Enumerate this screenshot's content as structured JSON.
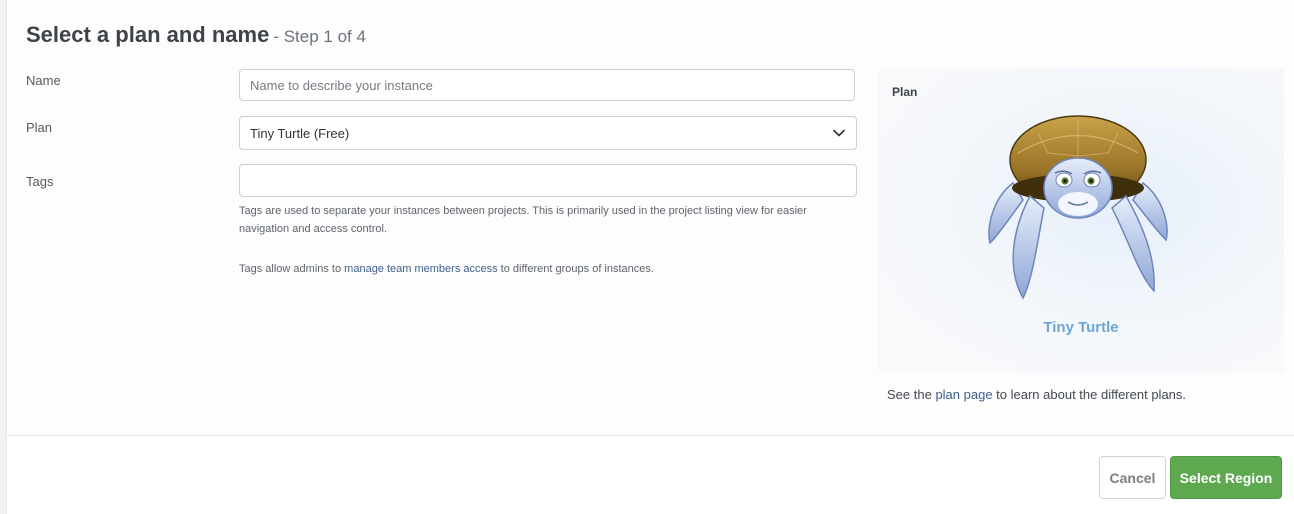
{
  "page": {
    "title": "Select a plan and name",
    "step": "- Step 1 of 4"
  },
  "form": {
    "name_label": "Name",
    "name_placeholder": "Name to describe your instance",
    "name_value": "",
    "plan_label": "Plan",
    "plan_selected": "Tiny Turtle (Free)",
    "tags_label": "Tags",
    "tags_value": "",
    "tags_help_1": "Tags are used to separate your instances between projects. This is primarily used in the project listing view for easier navigation and access control.",
    "tags_help_2_prefix": "Tags allow admins to ",
    "tags_help_2_link": "manage team members access",
    "tags_help_2_suffix": " to different groups of instances."
  },
  "plan_card": {
    "heading": "Plan",
    "image_icon": "turtle-mascot-icon",
    "name": "Tiny Turtle"
  },
  "plan_note": {
    "prefix": "See the ",
    "link": "plan page",
    "suffix": " to learn about the different plans."
  },
  "buttons": {
    "cancel": "Cancel",
    "next": "Select Region"
  },
  "colors": {
    "primary_button": "#5ea84f",
    "link": "#3e5f8a",
    "plan_name": "#6ea4d8"
  }
}
